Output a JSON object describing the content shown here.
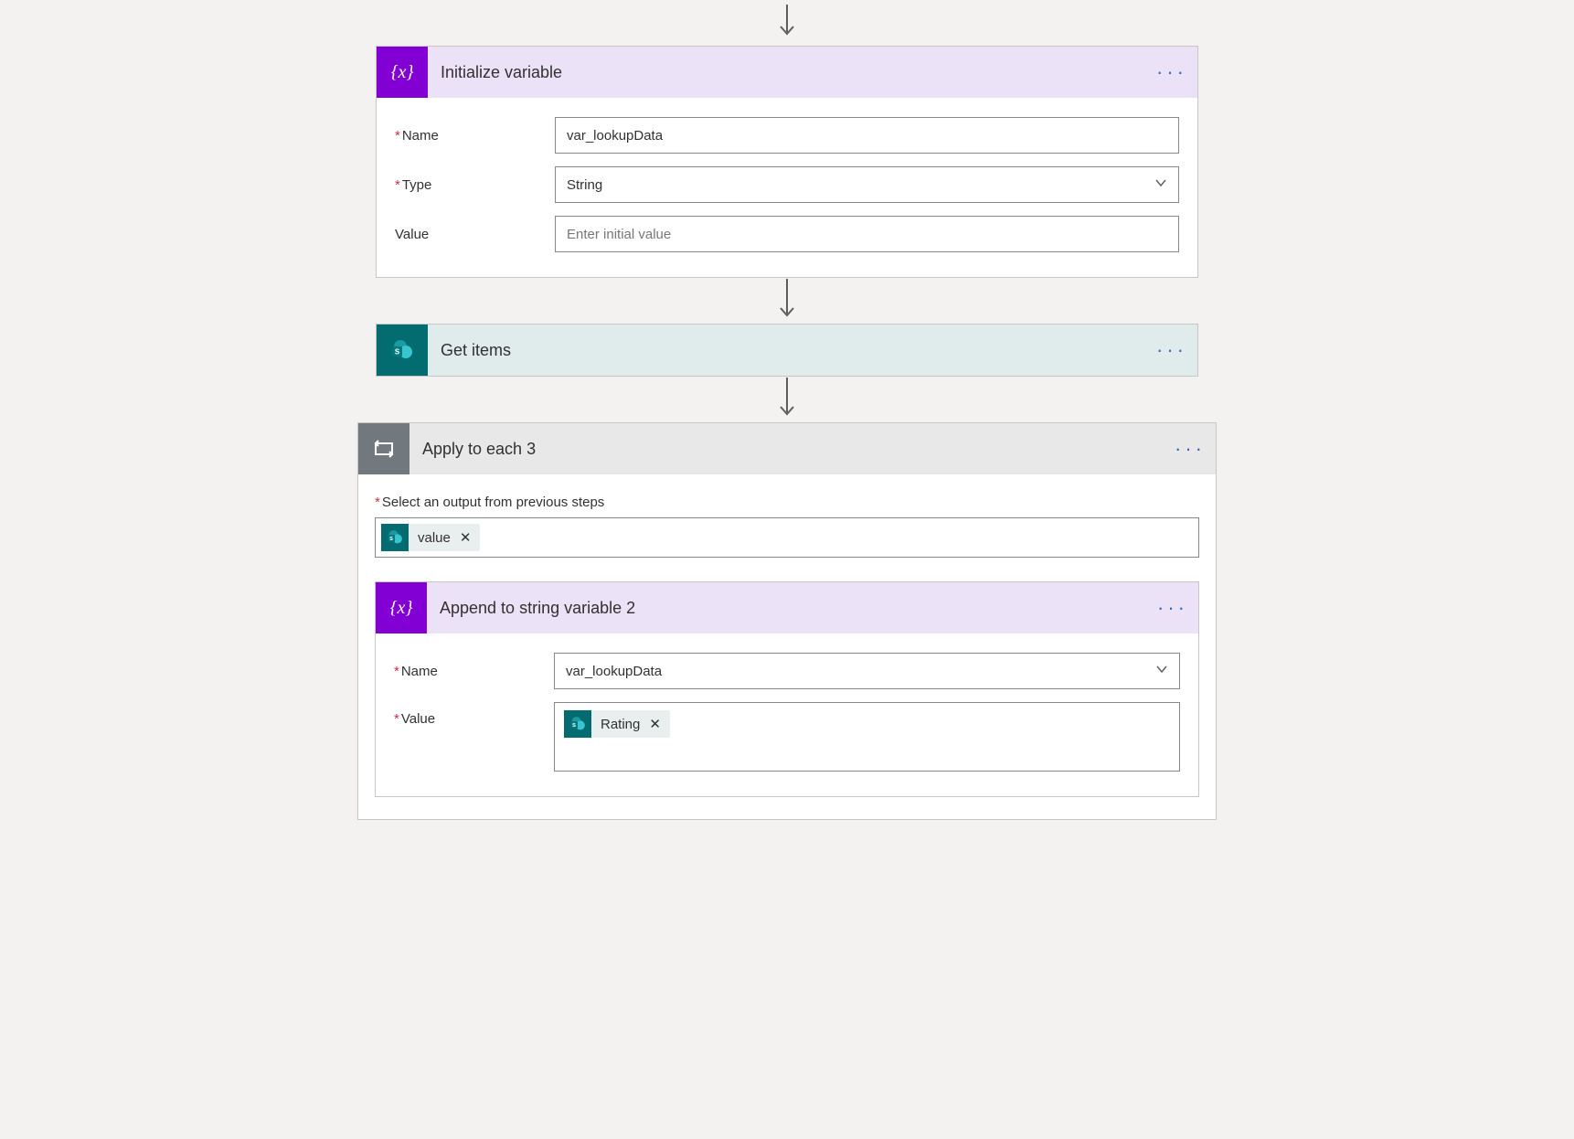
{
  "actions": {
    "initVar": {
      "title": "Initialize variable",
      "fields": {
        "nameLabel": "Name",
        "nameValue": "var_lookupData",
        "typeLabel": "Type",
        "typeValue": "String",
        "valueLabel": "Value",
        "valuePlaceholder": "Enter initial value"
      }
    },
    "getItems": {
      "title": "Get items"
    },
    "applyEach": {
      "title": "Apply to each 3",
      "selectLabel": "Select an output from previous steps",
      "token": {
        "text": "value"
      }
    },
    "append": {
      "title": "Append to string variable 2",
      "fields": {
        "nameLabel": "Name",
        "nameValue": "var_lookupData",
        "valueLabel": "Value",
        "token": {
          "text": "Rating"
        }
      }
    }
  }
}
